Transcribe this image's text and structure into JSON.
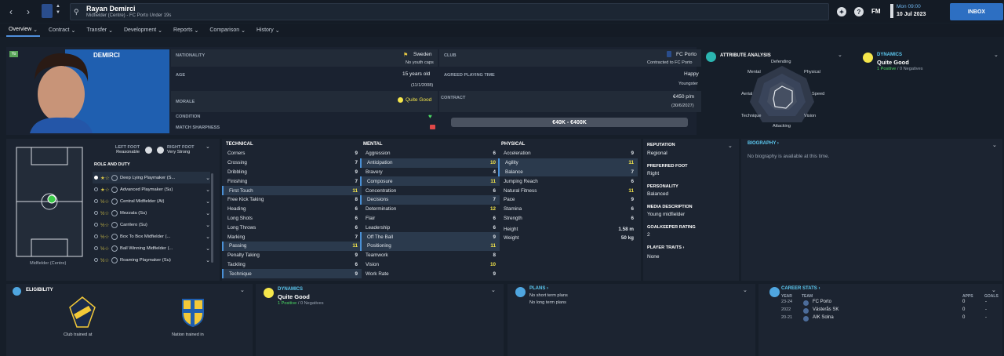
{
  "topbar": {
    "player_name": "Rayan Demirci",
    "player_sub": "Midfielder (Centre) - FC Porto Under 19s",
    "date_day": "Mon 09:00",
    "date": "10 Jul 2023",
    "inbox": "INBOX",
    "fm": "FM"
  },
  "tabs": [
    "Overview",
    "Contract",
    "Transfer",
    "Development",
    "Reports",
    "Comparison",
    "History"
  ],
  "profile": {
    "tag": "Yo",
    "surname": "DEMIRCI",
    "nationality_label": "NATIONALITY",
    "nationality": "Sweden",
    "youth_caps": "No youth caps",
    "club_label": "CLUB",
    "club": "FC Porto",
    "club_sub": "Contracted to FC Porto",
    "age_label": "AGE",
    "age": "15 years old",
    "dob": "(11/1/2008)",
    "apt_label": "AGREED PLAYING TIME",
    "apt": "Happy",
    "apt_sub": "Youngster",
    "morale_label": "MORALE",
    "morale": "Quite Good",
    "contract_label": "CONTRACT",
    "wage": "€450 p/m",
    "expiry": "(30/6/2027)",
    "condition_label": "CONDITION",
    "sharpness_label": "MATCH SHARPNESS",
    "value": "€40K - €400K"
  },
  "attr_analysis": {
    "title": "ATTRIBUTE ANALYSIS",
    "labels": [
      "Defending",
      "Physical",
      "Speed",
      "Vision",
      "Attacking",
      "Technique",
      "Aerial",
      "Mental"
    ]
  },
  "dynamics_top": {
    "title": "DYNAMICS",
    "value": "Quite Good",
    "positives": "1 Positive",
    "sep": "/",
    "negatives": "0 Negatives"
  },
  "pitch": {
    "position": "Midfielder (Centre)",
    "left_foot_label": "LEFT FOOT",
    "left_foot": "Reasonable",
    "right_foot_label": "RIGHT FOOT",
    "right_foot": "Very Strong",
    "role_title": "ROLE AND DUTY",
    "roles": [
      {
        "name": "Deep Lying Playmaker (S...",
        "stars": "★☆"
      },
      {
        "name": "Advanced Playmaker (Su)",
        "stars": "★☆"
      },
      {
        "name": "Central Midfielder (At)",
        "stars": "½☆"
      },
      {
        "name": "Mezzala (Su)",
        "stars": "½☆"
      },
      {
        "name": "Carrilero (Su)",
        "stars": "½☆"
      },
      {
        "name": "Box To Box Midfielder (...",
        "stars": "½☆"
      },
      {
        "name": "Ball Winning Midfielder (...",
        "stars": "½☆"
      },
      {
        "name": "Roaming Playmaker (Su)",
        "stars": "½☆"
      }
    ]
  },
  "technical": {
    "title": "TECHNICAL",
    "rows": [
      [
        "Corners",
        "9"
      ],
      [
        "Crossing",
        "7"
      ],
      [
        "Dribbling",
        "9"
      ],
      [
        "Finishing",
        "7"
      ],
      [
        "First Touch",
        "11"
      ],
      [
        "Free Kick Taking",
        "8"
      ],
      [
        "Heading",
        "6"
      ],
      [
        "Long Shots",
        "6"
      ],
      [
        "Long Throws",
        "6"
      ],
      [
        "Marking",
        "7"
      ],
      [
        "Passing",
        "11"
      ],
      [
        "Penalty Taking",
        "9"
      ],
      [
        "Tackling",
        "6"
      ],
      [
        "Technique",
        "9"
      ]
    ]
  },
  "mental": {
    "title": "MENTAL",
    "rows": [
      [
        "Aggression",
        "6"
      ],
      [
        "Anticipation",
        "10"
      ],
      [
        "Bravery",
        "4"
      ],
      [
        "Composure",
        "11"
      ],
      [
        "Concentration",
        "6"
      ],
      [
        "Decisions",
        "7"
      ],
      [
        "Determination",
        "12"
      ],
      [
        "Flair",
        "6"
      ],
      [
        "Leadership",
        "6"
      ],
      [
        "Off The Ball",
        "9"
      ],
      [
        "Positioning",
        "11"
      ],
      [
        "Teamwork",
        "8"
      ],
      [
        "Vision",
        "10"
      ],
      [
        "Work Rate",
        "9"
      ]
    ]
  },
  "physical": {
    "title": "PHYSICAL",
    "rows": [
      [
        "Acceleration",
        "9"
      ],
      [
        "Agility",
        "11"
      ],
      [
        "Balance",
        "7"
      ],
      [
        "Jumping Reach",
        "6"
      ],
      [
        "Natural Fitness",
        "11"
      ],
      [
        "Pace",
        "9"
      ],
      [
        "Stamina",
        "6"
      ],
      [
        "Strength",
        "6"
      ]
    ],
    "height_label": "Height",
    "height": "1.58 m",
    "weight_label": "Weight",
    "weight": "50 kg"
  },
  "info": {
    "reputation_label": "REPUTATION",
    "reputation": "Regional",
    "foot_label": "PREFERRED FOOT",
    "foot": "Right",
    "personality_label": "PERSONALITY",
    "personality": "Balanced",
    "media_label": "MEDIA DESCRIPTION",
    "media": "Young midfielder",
    "gk_label": "GOALKEEPER RATING",
    "gk": "2",
    "traits_label": "PLAYER TRAITS",
    "traits": "None"
  },
  "biography": {
    "title": "BIOGRAPHY",
    "text": "No biography is available at this time."
  },
  "eligibility": {
    "title": "ELIGIBILITY",
    "club": "Club trained at",
    "nation": "Nation trained in"
  },
  "dynamics_bottom": {
    "title": "DYNAMICS",
    "value": "Quite Good",
    "positives": "1 Positive",
    "sep": "/",
    "negatives": "0 Negatives"
  },
  "plans": {
    "title": "PLANS",
    "short": "No short term plans",
    "long": "No long term plans"
  },
  "career": {
    "title": "CAREER STATS",
    "col_year": "YEAR",
    "col_team": "TEAM",
    "col_apps": "APPS",
    "col_goals": "GOALS",
    "rows": [
      {
        "year": "23-24",
        "team": "FC Porto",
        "apps": "0",
        "goals": "-"
      },
      {
        "year": "2022",
        "team": "Västerås SK",
        "apps": "0",
        "goals": "-"
      },
      {
        "year": "20-21",
        "team": "AIK Solna",
        "apps": "0",
        "goals": "-"
      }
    ]
  },
  "colors": {
    "accent": "#4f8edb",
    "yellow": "#f5e64b",
    "green": "#4cd964",
    "inbox": "#2d6fc2"
  }
}
